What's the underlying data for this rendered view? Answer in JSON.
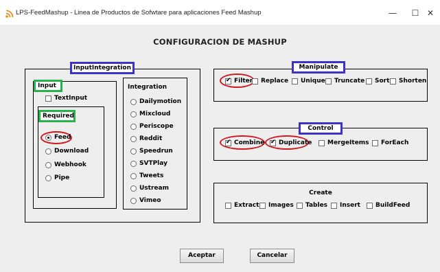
{
  "window": {
    "title": "LPS-FeedMashup - Linea de Productos de Sofwtare para aplicaciones Feed Mashup",
    "minimize": "—",
    "maximize": "☐",
    "close": "✕"
  },
  "heading": "CONFIGURACION DE MASHUP",
  "input_integration": {
    "title": "InputIntegration",
    "input": {
      "title": "Input",
      "textinput": {
        "label": "TextInput",
        "checked": false
      }
    },
    "required": {
      "title": "Required",
      "options": [
        {
          "label": "Feed",
          "selected": true
        },
        {
          "label": "Download",
          "selected": false
        },
        {
          "label": "Webhook",
          "selected": false
        },
        {
          "label": "Pipe",
          "selected": false
        }
      ]
    },
    "integration": {
      "title": "Integration",
      "options": [
        "Dailymotion",
        "Mixcloud",
        "Periscope",
        "Reddit",
        "Speedrun",
        "SVTPlay",
        "Tweets",
        "Ustream",
        "Vimeo"
      ]
    }
  },
  "manipulate": {
    "title": "Manipulate",
    "items": [
      {
        "label": "Filter",
        "checked": true
      },
      {
        "label": "Replace",
        "checked": false
      },
      {
        "label": "Unique",
        "checked": false
      },
      {
        "label": "Truncate",
        "checked": false
      },
      {
        "label": "Sort",
        "checked": false
      },
      {
        "label": "Shorten",
        "checked": false
      }
    ]
  },
  "control": {
    "title": "Control",
    "items": [
      {
        "label": "Combine",
        "checked": true
      },
      {
        "label": "Duplicate",
        "checked": true
      },
      {
        "label": "MergeItems",
        "checked": false
      },
      {
        "label": "ForEach",
        "checked": false
      }
    ]
  },
  "create": {
    "title": "Create",
    "items": [
      {
        "label": "Extract",
        "checked": false
      },
      {
        "label": "Images",
        "checked": false
      },
      {
        "label": "Tables",
        "checked": false
      },
      {
        "label": "Insert",
        "checked": false
      },
      {
        "label": "BuildFeed",
        "checked": false
      }
    ]
  },
  "buttons": {
    "accept": "Aceptar",
    "cancel": "Cancelar"
  },
  "colors": {
    "annotation_blue": "#3d33c8",
    "annotation_green": "#25b34a",
    "annotation_red": "#d0161e",
    "rss_orange": "#f08a1c"
  },
  "icons": {
    "app": "rss-icon"
  }
}
